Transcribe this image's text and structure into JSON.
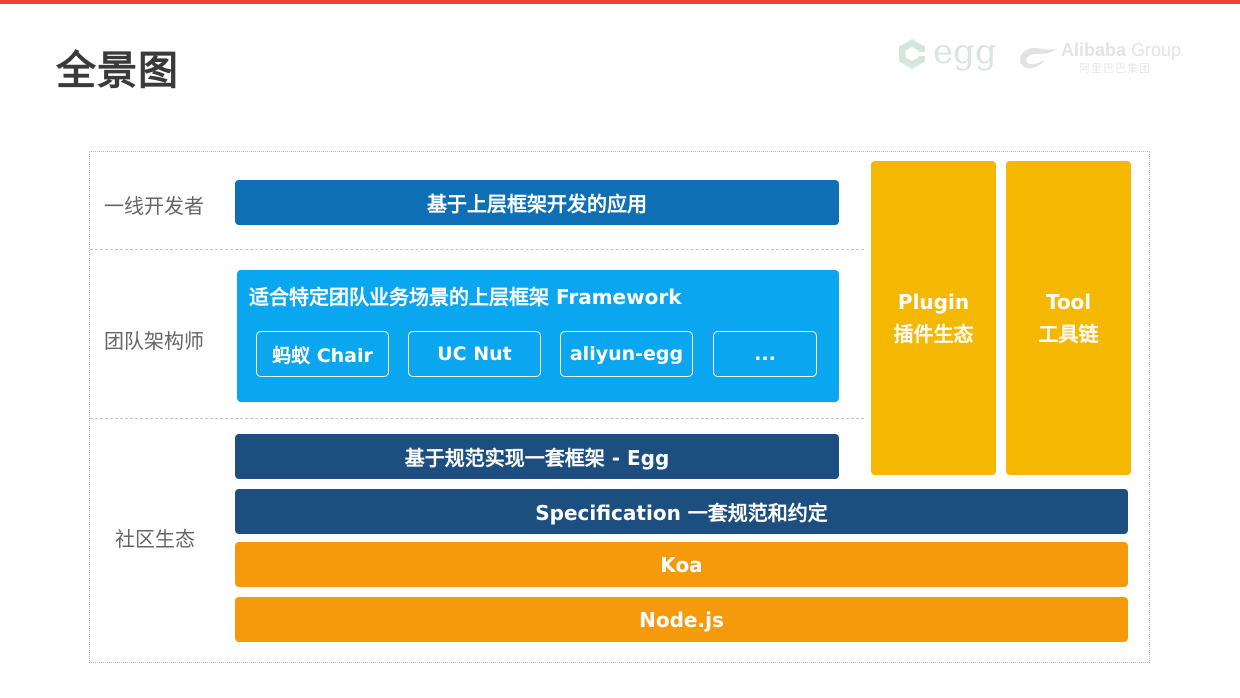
{
  "page": {
    "title": "全景图"
  },
  "logos": {
    "egg_wordmark": "egg",
    "alibaba_en": "Alibaba",
    "alibaba_group": "Group",
    "alibaba_cn": "阿里巴巴集团",
    "egg_icon": "egg-logo-icon",
    "alibaba_icon": "alibaba-logo-icon"
  },
  "rows": {
    "developer": "一线开发者",
    "architect": "团队架构师",
    "community": "社区生态"
  },
  "layers": {
    "app": "基于上层框架开发的应用",
    "framework_title": "适合特定团队业务场景的上层框架 Framework",
    "frameworks": [
      "蚂蚁 Chair",
      "UC Nut",
      "aliyun-egg",
      "..."
    ],
    "egg": "基于规范实现一套框架 - Egg",
    "spec": "Specification 一套规范和约定",
    "koa": "Koa",
    "node": "Node.js"
  },
  "side": {
    "plugin_en": "Plugin",
    "plugin_cn": "插件生态",
    "tool_en": "Tool",
    "tool_cn": "工具链"
  },
  "colors": {
    "accent_red": "#e8423b",
    "app_blue": "#0f6fb5",
    "framework_blue": "#0aa6f0",
    "navy": "#1c4e80",
    "orange": "#f59a0a",
    "yellow": "#f5b800"
  }
}
